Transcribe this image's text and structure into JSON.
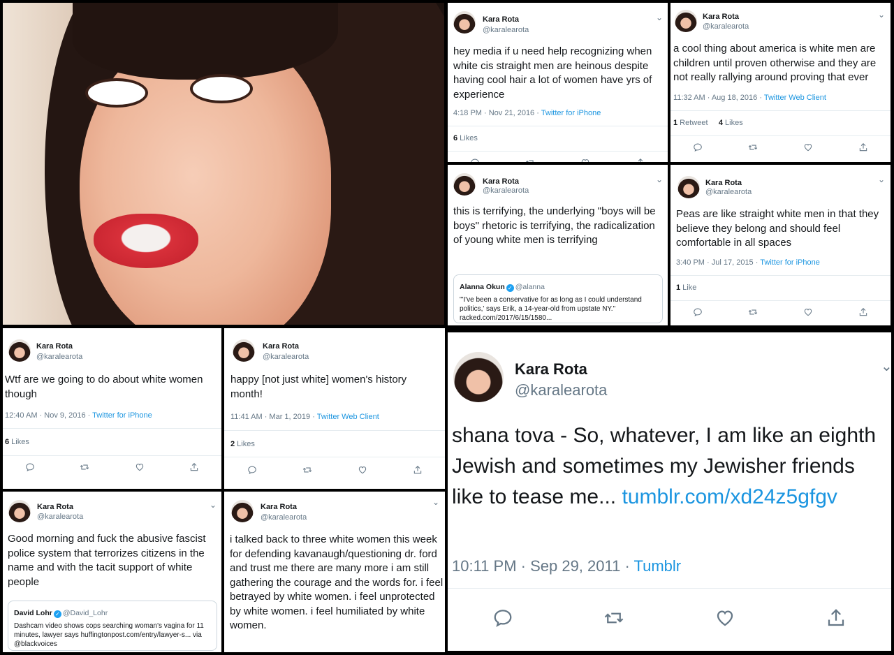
{
  "profile": {
    "name": "Kara Rota",
    "handle": "@karalearota"
  },
  "tweets": [
    {
      "body": "hey media if u need help recognizing when white cis straight men are heinous despite having cool hair a lot of women have yrs of experience",
      "time": "4:18 PM · Nov 21, 2016 · ",
      "source": "Twitter for iPhone",
      "stats_count": "6",
      "stats_label": " Likes"
    },
    {
      "body": "a cool thing about america is white men are children until proven otherwise and they are not really rallying around proving that ever",
      "time": "11:32 AM · Aug 18, 2016 · ",
      "source": "Twitter Web Client",
      "retweets_count": "1",
      "retweets_label": " Retweet",
      "likes_count": "4",
      "likes_label": " Likes"
    },
    {
      "body": "this is terrifying, the underlying \"boys will be boys\" rhetoric is terrifying, the radicalization of young white men is terrifying",
      "quote": {
        "name": "Alanna Okun",
        "handle": "@alanna",
        "text": "\"'I've been a conservative for as long as I could understand politics,' says Erik, a 14-year-old from upstate NY.\" racked.com/2017/6/15/1580..."
      }
    },
    {
      "body": "Peas are like straight white men in that they believe they belong and should feel comfortable in all spaces",
      "time": "3:40 PM · Jul 17, 2015 · ",
      "source": "Twitter for iPhone",
      "stats_count": "1",
      "stats_label": " Like"
    },
    {
      "body": "Wtf are we going to do about white women though",
      "time": "12:40 AM · Nov 9, 2016 · ",
      "source": "Twitter for iPhone",
      "stats_count": "6",
      "stats_label": " Likes"
    },
    {
      "body": "happy [not just white] women's history month!",
      "time": "11:41 AM · Mar 1, 2019 · ",
      "source": "Twitter Web Client",
      "stats_count": "2",
      "stats_label": " Likes"
    },
    {
      "body": "Good morning and fuck the abusive fascist police system that terrorizes citizens in the name and with the tacit support of white people",
      "quote": {
        "name": "David Lohr",
        "handle": "@David_Lohr",
        "text": "Dashcam video shows cops searching woman's vagina for 11 minutes, lawyer says huffingtonpost.com/entry/lawyer-s... via @blackvoices"
      }
    },
    {
      "body": "i talked back to three white women this week for defending kavanaugh/questioning dr. ford and trust me there are many more i am still gathering the courage and the words for. i feel betrayed by white women. i feel unprotected by white women. i feel humiliated by white women."
    },
    {
      "body": "shana tova - So, whatever, I am like an eighth Jewish and sometimes my Jewisher friends like to tease me...",
      "link": "tumblr.com/xd24z5gfgv",
      "time": "10:11 PM · Sep 29, 2011 · ",
      "source": "Tumblr"
    }
  ],
  "colors": {
    "link": "#1b95e0",
    "text": "#14171a",
    "muted": "#657786",
    "verified": "#1da1f2"
  },
  "icons": [
    "reply-icon",
    "retweet-icon",
    "like-icon",
    "share-icon",
    "chevron-down-icon",
    "verified-badge-icon"
  ]
}
